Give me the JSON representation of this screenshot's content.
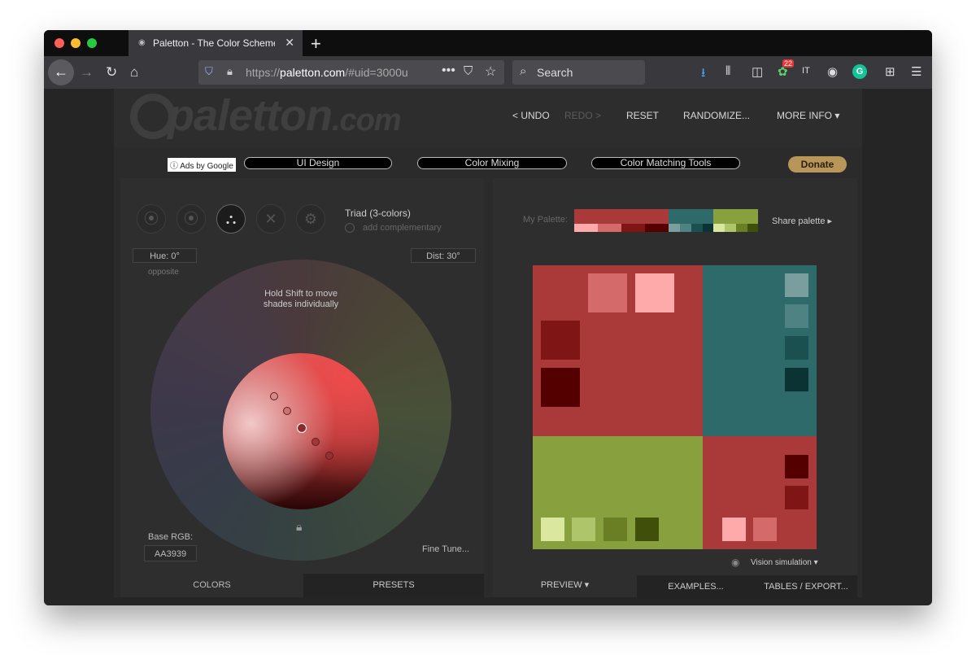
{
  "browser": {
    "tab_title": "Paletton - The Color Scheme Designer",
    "new_tab": "+",
    "url_prefix": "https://",
    "url_host": "paletton.com",
    "url_path": "/#uid=3000u",
    "search_placeholder": "Search",
    "notification_badge": "22",
    "grammarly_letter": "G"
  },
  "site": {
    "logo_text": "paletton",
    "logo_tld": ".com",
    "menu": {
      "undo": "< UNDO",
      "redo": "REDO >",
      "reset": "RESET",
      "randomize": "RANDOMIZE...",
      "more_info": "MORE INFO ▾"
    }
  },
  "ads": {
    "label": "ⓘ Ads by Google",
    "links": [
      "UI Design",
      "Color Mixing",
      "Color Matching Tools"
    ],
    "donate": "Donate"
  },
  "left_panel": {
    "scheme_name": "Triad (3-colors)",
    "add_complementary": "add complementary",
    "hue": "Hue: 0°",
    "hue_sub": "opposite",
    "dist": "Dist: 30°",
    "hint": "Hold Shift to move shades individually",
    "base_rgb_label": "Base RGB:",
    "base_rgb_value": "AA3939",
    "fine_tune": "Fine Tune...",
    "tabs": [
      "COLORS",
      "PRESETS"
    ]
  },
  "right_panel": {
    "my_palette_label": "My Palette:",
    "share": "Share palette ▸",
    "vision_sim": "Vision simulation ▾",
    "tabs": [
      "PREVIEW ▾",
      "EXAMPLES...",
      "TABLES / EXPORT..."
    ]
  },
  "colors": {
    "primary": "#AA3939",
    "primary_shades": [
      "#D46A6A",
      "#FFAAAA",
      "#801515",
      "#550000"
    ],
    "teal": "#2E6A6A",
    "teal_shades": [
      "#7A9E9E",
      "#4F8383",
      "#1A5050",
      "#0B3333"
    ],
    "green": "#88A03E",
    "green_shades": [
      "#D9E89E",
      "#AEC56A",
      "#6A7F23",
      "#404F0A"
    ],
    "donate_bg": "#B8965A"
  }
}
